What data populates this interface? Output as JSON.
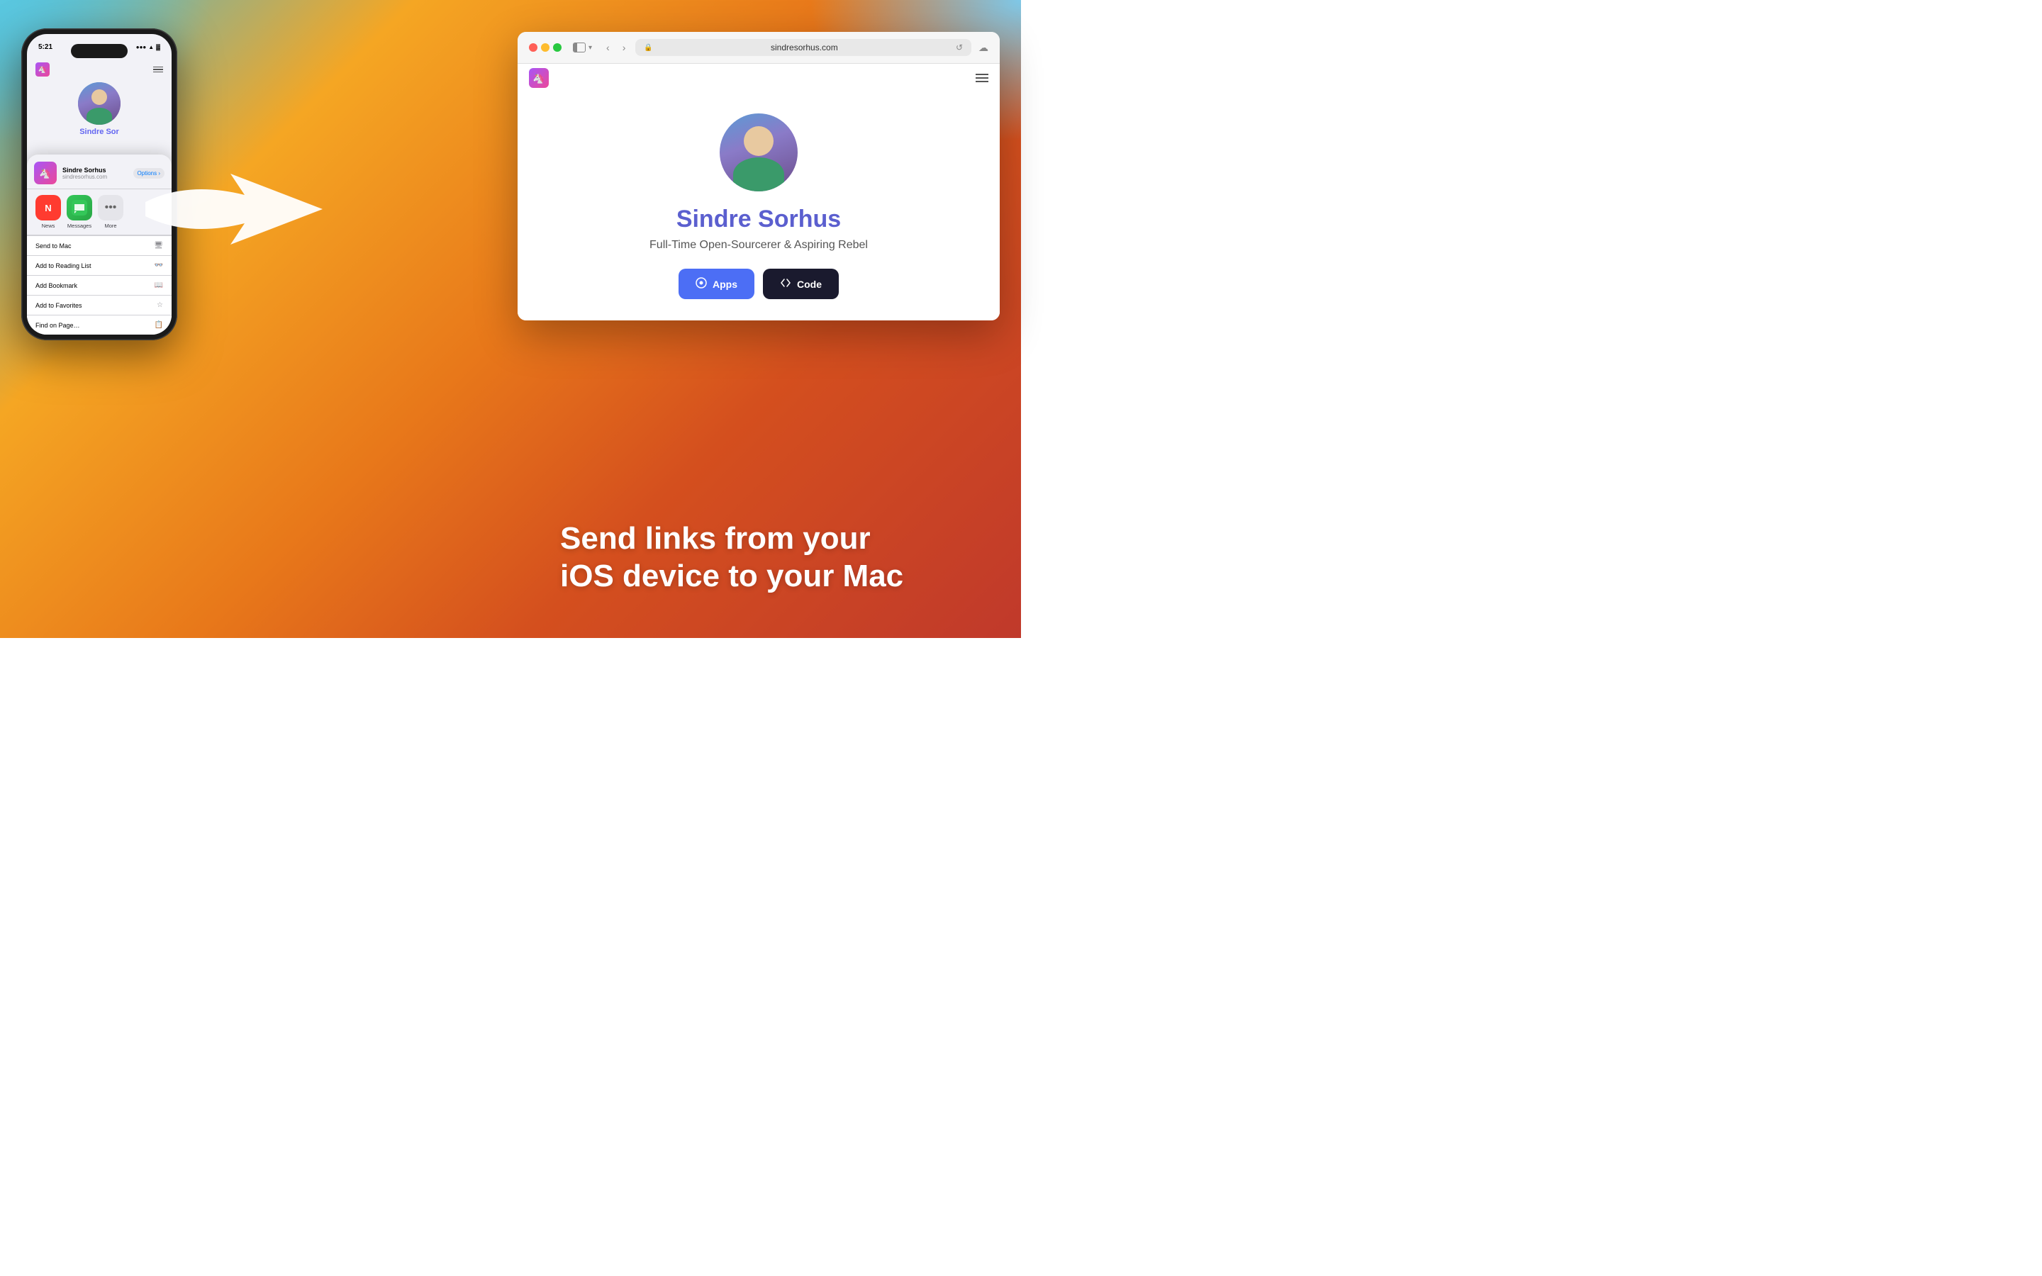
{
  "background": {
    "gradient_desc": "orange-red gradient with blue teal top corners"
  },
  "phone": {
    "status_time": "5:21",
    "status_bars": "●●●",
    "status_wifi": "WiFi",
    "status_battery": "Battery",
    "nav_unicorn": "🦄",
    "site_name": "Sindre Sorhus",
    "site_url": "sindresorhus.com",
    "options_label": "Options ›",
    "share_name_truncated": "Sindre Sor",
    "apps": [
      {
        "label": "News",
        "type": "news"
      },
      {
        "label": "Messages",
        "type": "messages"
      },
      {
        "label": "More",
        "type": "more"
      }
    ],
    "menu_items": [
      {
        "label": "Send to Mac",
        "icon": "🖥"
      },
      {
        "label": "Add to Reading List",
        "icon": "👓"
      },
      {
        "label": "Add Bookmark",
        "icon": "📖"
      },
      {
        "label": "Add to Favorites",
        "icon": "☆"
      },
      {
        "label": "Find on Page…",
        "icon": "📋"
      }
    ]
  },
  "browser": {
    "url": "sindresorhus.com",
    "unicorn_emoji": "🦄",
    "name": "Sindre Sorhus",
    "subtitle": "Full-Time Open-Sourcerer & Aspiring Rebel",
    "btn_apps_label": "Apps",
    "btn_apps_icon": "⊕",
    "btn_code_label": "Code",
    "btn_code_icon": "⌥"
  },
  "headline": {
    "line1": "Send links from your",
    "line2": "iOS device to your Mac"
  }
}
